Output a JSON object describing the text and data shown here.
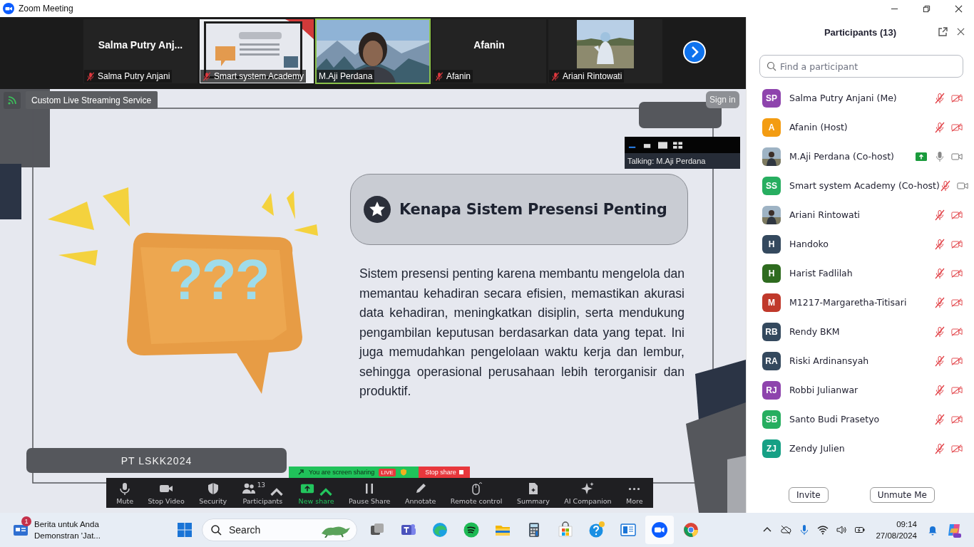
{
  "window": {
    "title": "Zoom Meeting"
  },
  "video_strip": {
    "tiles": [
      {
        "name": "Salma Putry Anjani",
        "big_name": "Salma Putry Anj...",
        "kind": "name",
        "muted": true,
        "speaking": false
      },
      {
        "name": "Smart system Academy",
        "kind": "screen",
        "muted": true,
        "speaking": false
      },
      {
        "name": "M.Aji Perdana",
        "kind": "video",
        "muted": false,
        "speaking": true
      },
      {
        "name": "Afanin",
        "big_name": "Afanin",
        "kind": "name",
        "muted": true,
        "speaking": false
      },
      {
        "name": "Ariani Rintowati",
        "muted": true,
        "speaking": false
      }
    ]
  },
  "stream_bar": {
    "label": "Custom Live Streaming Service",
    "sign_in": "Sign in"
  },
  "talking": {
    "text": "Talking: M.Aji Perdana"
  },
  "slide": {
    "title": "Kenapa Sistem Presensi Penting",
    "body": "Sistem presensi penting karena membantu mengelola dan memantau kehadiran secara efisien, memastikan akurasi data kehadiran, meningkatkan disiplin, serta mendukung pengambilan keputusan berdasarkan data yang tepat. Ini juga memudahkan pengelolaan waktu kerja dan lembur, sehingga operasional perusahaan lebih terorganisir dan produktif.",
    "bubble_text": "???",
    "footer": "PT LSKK2024"
  },
  "share_banner": {
    "text": "You are screen sharing",
    "live": "LIVE",
    "stop": "Stop share"
  },
  "toolbar": [
    {
      "label": "Mute",
      "kind": "mic"
    },
    {
      "label": "Stop Video",
      "kind": "video"
    },
    {
      "label": "Security",
      "kind": "shield"
    },
    {
      "label": "Participants",
      "kind": "people",
      "count": "13",
      "caret": true
    },
    {
      "label": "New share",
      "kind": "share",
      "caret": true,
      "active": true
    },
    {
      "label": "Pause Share",
      "kind": "pause"
    },
    {
      "label": "Annotate",
      "kind": "pen"
    },
    {
      "label": "Remote control",
      "kind": "mouse"
    },
    {
      "label": "Summary",
      "kind": "doc"
    },
    {
      "label": "AI Companion",
      "kind": "sparkle"
    },
    {
      "label": "More",
      "kind": "dots"
    }
  ],
  "participants": {
    "title": "Participants (13)",
    "search": {
      "placeholder": "Find a participant"
    },
    "items": [
      {
        "name": "Salma Putry Anjani (Me)",
        "initials": "SP",
        "color": "#8e44ad",
        "muted": true,
        "video": false,
        "sharing": false
      },
      {
        "name": "Afanin (Host)",
        "initials": "A",
        "color": "#f39c12",
        "muted": true,
        "video": false,
        "sharing": false
      },
      {
        "name": "M.Aji Perdana (Co-host)",
        "muted": false,
        "video": true,
        "sharing": true
      },
      {
        "name": "Smart system Academy (Co-host)",
        "initials": "SS",
        "color": "#27ae60",
        "muted": true,
        "video": true,
        "sharing": false
      },
      {
        "name": "Ariani Rintowati",
        "muted": true,
        "video": false,
        "sharing": false
      },
      {
        "name": "Handoko",
        "initials": "H",
        "color": "#34495e",
        "muted": true,
        "video": false,
        "sharing": false
      },
      {
        "name": "Harist Fadlilah",
        "initials": "H",
        "color": "#2e6b1f",
        "muted": true,
        "video": false,
        "sharing": false
      },
      {
        "name": "M1217-Margaretha-Titisari",
        "initials": "M",
        "color": "#c0392b",
        "muted": true,
        "video": false,
        "sharing": false
      },
      {
        "name": "Rendy BKM",
        "initials": "RB",
        "color": "#34495e",
        "muted": true,
        "video": false,
        "sharing": false
      },
      {
        "name": "Riski Ardinansyah",
        "initials": "RA",
        "color": "#34495e",
        "muted": true,
        "video": false,
        "sharing": false
      },
      {
        "name": "Robbi Julianwar",
        "initials": "RJ",
        "color": "#8e44ad",
        "muted": true,
        "video": false,
        "sharing": false
      },
      {
        "name": "Santo Budi Prasetyo",
        "initials": "SB",
        "color": "#27ae60",
        "muted": true,
        "video": false,
        "sharing": false
      },
      {
        "name": "Zendy Julien",
        "initials": "ZJ",
        "color": "#16a085",
        "muted": true,
        "video": false,
        "sharing": false
      }
    ],
    "buttons": [
      "Invite",
      "Unmute Me"
    ]
  },
  "taskbar": {
    "news": {
      "badge": "1",
      "title": "Berita untuk Anda",
      "subtitle": "Demonstran 'Jat..."
    },
    "search": {
      "placeholder": "Search"
    },
    "time": "09:14",
    "date": "27/08/2024"
  }
}
